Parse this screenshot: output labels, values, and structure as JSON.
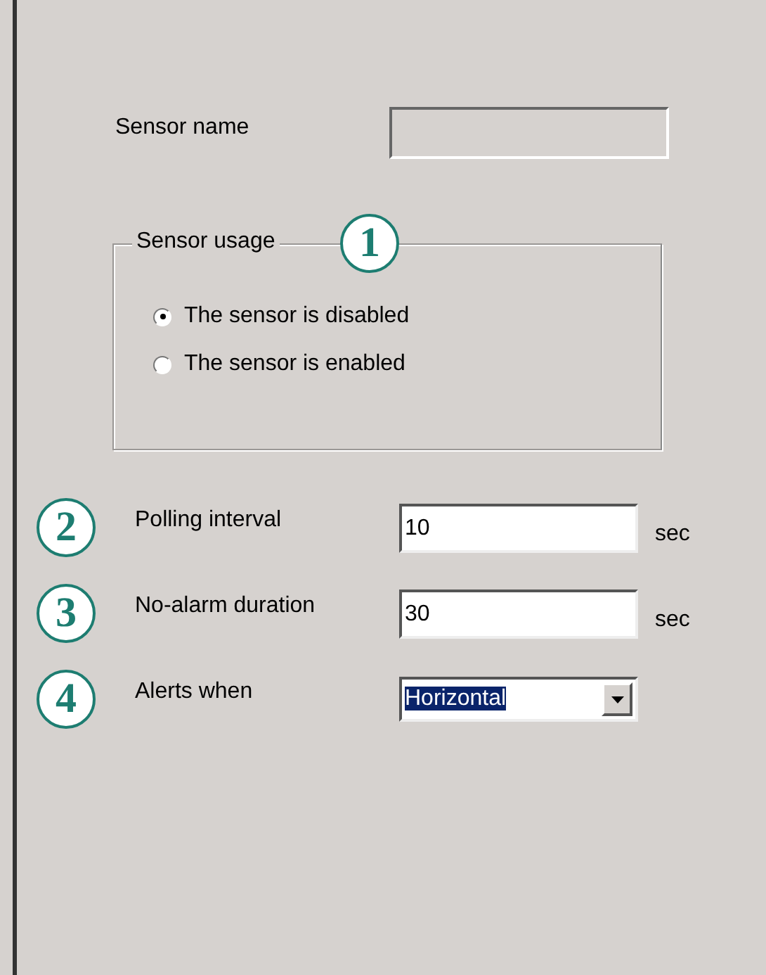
{
  "sensor_name": {
    "label": "Sensor name",
    "disabled": true
  },
  "sensor_usage": {
    "title": "Sensor usage",
    "callout": "1",
    "options": [
      {
        "label": "The sensor is disabled",
        "selected": true
      },
      {
        "label": "The sensor is enabled",
        "selected": false
      }
    ]
  },
  "settings": [
    {
      "callout": "2",
      "label": "Polling interval",
      "kind": "text",
      "value": "10",
      "unit": "sec"
    },
    {
      "callout": "3",
      "label": "No-alarm duration",
      "kind": "text",
      "value": "30",
      "unit": "sec"
    },
    {
      "callout": "4",
      "label": "Alerts when",
      "kind": "dropdown",
      "value": "Horizontal",
      "highlighted": true
    }
  ]
}
